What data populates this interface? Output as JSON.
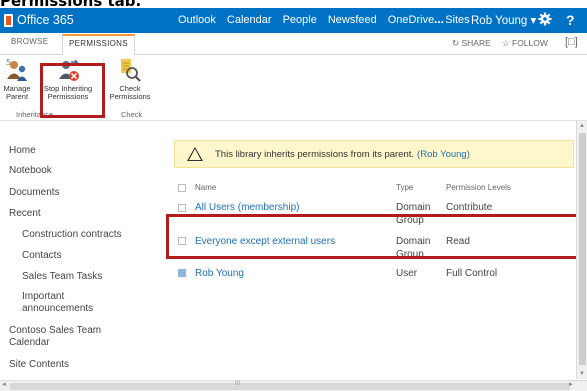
{
  "caption": "Permissions tab.",
  "suite_bar": {
    "brand": "Office 365",
    "nav": [
      "Outlook",
      "Calendar",
      "People",
      "Newsfeed",
      "OneDrive",
      "Sites"
    ],
    "active": "Sites",
    "more": "...",
    "user": "Rob Young ▾",
    "gear_icon": "gear-icon",
    "help": "?",
    "color": "#0072c6"
  },
  "ribbon_tabs": {
    "browse": "BROWSE",
    "permissions": "PERMISSIONS",
    "share": "SHARE",
    "follow": "FOLLOW",
    "focus_icon": "[□]"
  },
  "ribbon": {
    "manage_parent": [
      "Manage",
      "Parent"
    ],
    "stop_inheriting": [
      "Stop Inheriting",
      "Permissions"
    ],
    "check_permissions": [
      "Check",
      "Permissions"
    ],
    "group_inheritance": "Inheritance",
    "group_check": "Check"
  },
  "left_nav": {
    "items": [
      "Home",
      "Notebook",
      "Documents",
      "Recent",
      "Construction contracts",
      "Contacts",
      "Sales Team Tasks",
      "Important announcements",
      "Contoso Sales Team Calendar",
      "Site Contents"
    ]
  },
  "notice": {
    "text": "This library inherits permissions from its parent.",
    "link": "(Rob Young)"
  },
  "table": {
    "headers": [
      "Name",
      "Type",
      "Permission Levels"
    ],
    "rows": [
      {
        "name": "All Users (membership)",
        "type": [
          "Domain",
          "Group"
        ],
        "level": "Contribute"
      },
      {
        "name": "Everyone except external users",
        "type": [
          "Domain",
          "Group"
        ],
        "level": "Read"
      },
      {
        "name": "Rob Young",
        "type": [
          "User"
        ],
        "level": "Full Control"
      }
    ]
  },
  "scroll": {
    "h_mark": "III"
  },
  "colors": {
    "accent": "#0072c6",
    "highlight_box": "#b31c1c",
    "link": "#1f6fb5",
    "notice_bg": "#fff7cc",
    "tab_accent": "#ff9933"
  }
}
